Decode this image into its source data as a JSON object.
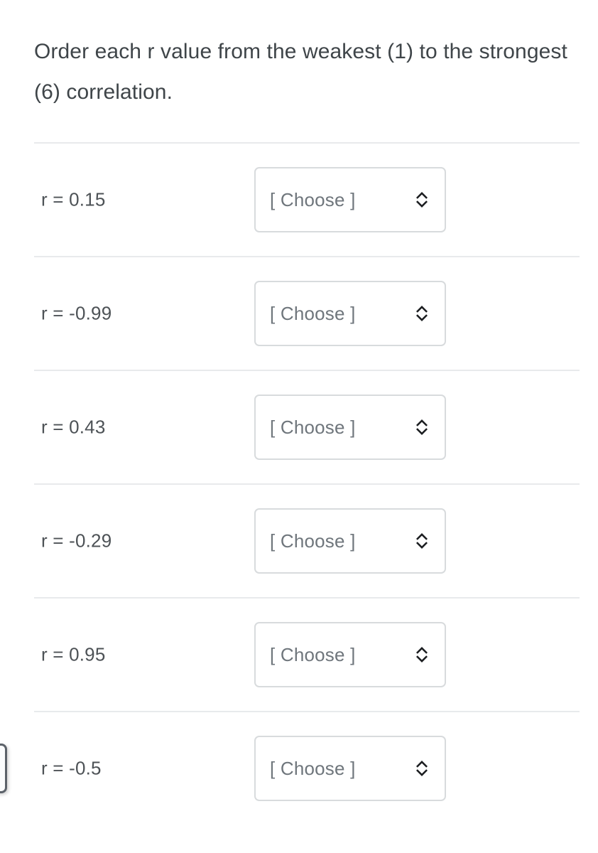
{
  "prompt": {
    "text": "Order each r value from the weakest (1) to the strongest (6) correlation."
  },
  "colors": {
    "text": "#3f4549",
    "label": "#4d5256",
    "placeholder": "#6f767c",
    "divider": "#e8eaec",
    "select_border": "#d8dbdd",
    "background": "#ffffff"
  },
  "dropdown": {
    "placeholder": "[ Choose ]",
    "icon": "up-down-chevron-icon"
  },
  "rows": [
    {
      "label": "r = 0.15",
      "value": 0.15,
      "selection": "[ Choose ]"
    },
    {
      "label": "r = -0.99",
      "value": -0.99,
      "selection": "[ Choose ]"
    },
    {
      "label": "r = 0.43",
      "value": 0.43,
      "selection": "[ Choose ]"
    },
    {
      "label": "r = -0.29",
      "value": -0.29,
      "selection": "[ Choose ]"
    },
    {
      "label": "r = 0.95",
      "value": 0.95,
      "selection": "[ Choose ]"
    },
    {
      "label": "r = -0.5",
      "value": -0.5,
      "selection": "[ Choose ]"
    }
  ]
}
